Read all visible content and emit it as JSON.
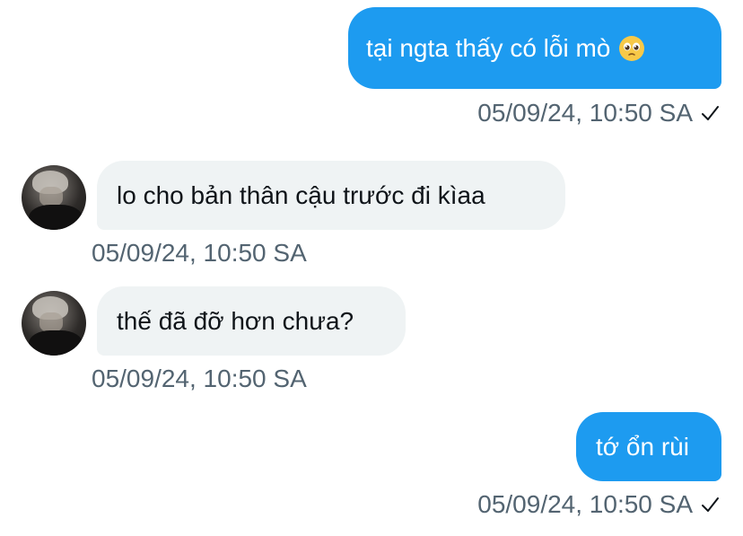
{
  "messages": [
    {
      "direction": "outgoing",
      "text": "tại ngta thấy có lỗi mò",
      "emoji": "pleading-face-emoji",
      "timestamp": "05/09/24, 10:50 SA",
      "status_icon": "check-icon"
    },
    {
      "direction": "incoming",
      "text": "lo cho bản thân cậu trước đi kìaa",
      "timestamp": "05/09/24, 10:50 SA",
      "avatar_icon": "avatar"
    },
    {
      "direction": "incoming",
      "text": "thế đã đỡ hơn chưa?",
      "timestamp": "05/09/24, 10:50 SA",
      "avatar_icon": "avatar"
    },
    {
      "direction": "outgoing",
      "text": "tớ ổn rùi",
      "timestamp": "05/09/24, 10:50 SA",
      "status_icon": "check-icon"
    }
  ],
  "colors": {
    "outgoing_bubble": "#1d9bf0",
    "incoming_bubble": "#eff3f4",
    "timestamp_text": "#536471"
  }
}
